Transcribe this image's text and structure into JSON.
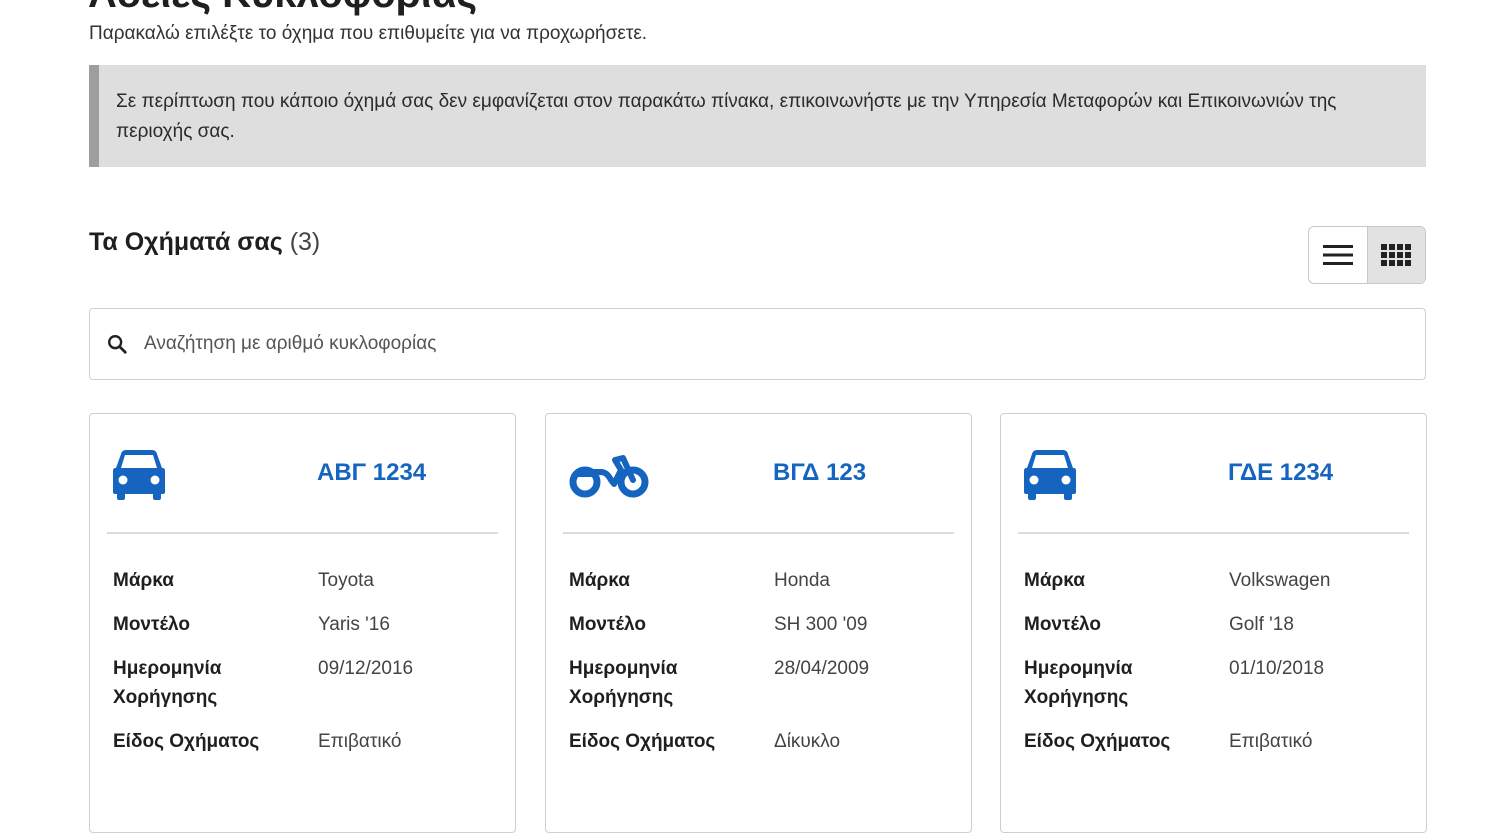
{
  "header": {
    "title": "Άδειες Κυκλοφορίας",
    "subtitle": "Παρακαλώ επιλέξτε το όχημα που επιθυμείτε για να προχωρήσετε."
  },
  "notice": {
    "text": "Σε περίπτωση που κάποιο όχημά σας δεν εμφανίζεται στον παρακάτω πίνακα, επικοινωνήστε με την Υπηρεσία Μεταφορών και Επικοινωνιών της περιοχής σας."
  },
  "vehicles": {
    "heading": "Τα Οχήματά σας",
    "count": "(3)",
    "view_toggle": {
      "list_icon": "list-view-icon",
      "grid_icon": "grid-view-icon",
      "active": "grid"
    },
    "search": {
      "placeholder": "Αναζήτηση με αριθμό κυκλοφορίας",
      "icon": "search-icon"
    },
    "labels": {
      "brand": "Μάρκα",
      "model": "Μοντέλο",
      "issue_date": "Ημερομηνία Χορήγησης",
      "vehicle_type": "Είδος Οχήματος"
    },
    "cards": [
      {
        "icon": "car-icon",
        "plate": "ΑΒΓ 1234",
        "brand": "Toyota",
        "model": "Yaris '16",
        "issue_date": "09/12/2016",
        "vehicle_type": "Επιβατικό"
      },
      {
        "icon": "motorcycle-icon",
        "plate": "ΒΓΔ 123",
        "brand": "Honda",
        "model": "SH 300 '09",
        "issue_date": "28/04/2009",
        "vehicle_type": "Δίκυκλο"
      },
      {
        "icon": "car-icon",
        "plate": "ΓΔΕ 1234",
        "brand": "Volkswagen",
        "model": "Golf '18",
        "issue_date": "01/10/2018",
        "vehicle_type": "Επιβατικό"
      }
    ]
  },
  "colors": {
    "accent": "#1565c0",
    "notice_bg": "#dedede",
    "notice_border": "#9e9e9e"
  }
}
